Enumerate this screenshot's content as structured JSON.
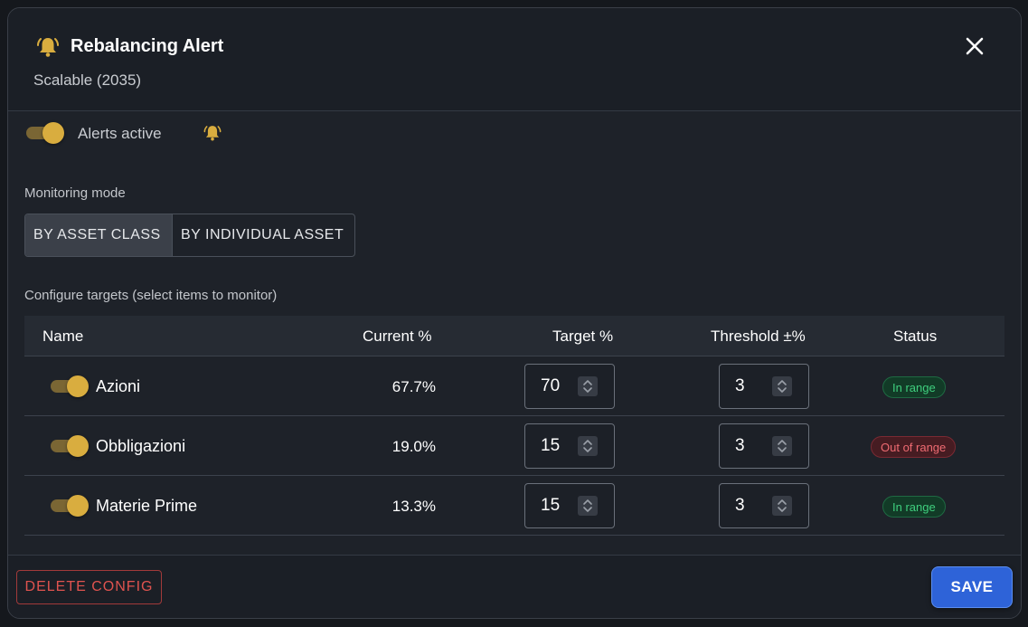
{
  "dialog": {
    "title": "Rebalancing Alert",
    "subtitle": "Scalable (2035)",
    "icon": "bell-icon",
    "close_icon": "close-icon"
  },
  "alerts": {
    "label": "Alerts active",
    "enabled": true,
    "status_icon": "bell-icon"
  },
  "monitoring": {
    "label": "Monitoring mode",
    "options": [
      "BY ASSET CLASS",
      "BY INDIVIDUAL ASSET"
    ],
    "selected": "BY ASSET CLASS"
  },
  "targets": {
    "label": "Configure targets (select items to monitor)",
    "columns": [
      "Name",
      "Current %",
      "Target %",
      "Threshold ±%",
      "Status"
    ],
    "rows": [
      {
        "enabled": true,
        "name": "Azioni",
        "current": "67.7%",
        "target": "70",
        "threshold": "3",
        "status": "In range",
        "status_type": "ok"
      },
      {
        "enabled": true,
        "name": "Obbligazioni",
        "current": "19.0%",
        "target": "15",
        "threshold": "3",
        "status": "Out of range",
        "status_type": "bad"
      },
      {
        "enabled": true,
        "name": "Materie Prime",
        "current": "13.3%",
        "target": "15",
        "threshold": "3",
        "status": "In range",
        "status_type": "ok"
      }
    ]
  },
  "footer": {
    "delete_label": "DELETE CONFIG",
    "save_label": "SAVE"
  },
  "colors": {
    "accent_gold": "#d9ad3f",
    "primary_blue": "#2e63d8",
    "danger_red": "#e0534f",
    "success_green": "#3fcf7e"
  }
}
